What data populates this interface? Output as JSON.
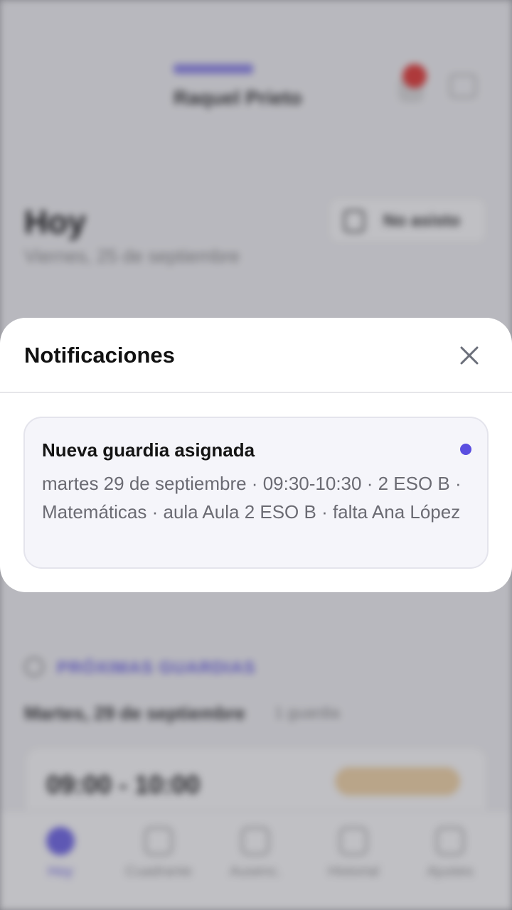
{
  "background": {
    "header": {
      "name": "Raquel Prieto"
    },
    "today": {
      "title": "Hoy",
      "date": "Viernes, 25 de septiembre"
    },
    "no_school_button": {
      "label": "No asisto",
      "icon": "calendar-icon"
    },
    "upcoming": {
      "label": "PRÓXIMAS GUARDIAS",
      "day": "Martes, 29 de septiembre",
      "count": "1 guardia"
    },
    "slot": {
      "time": "09:00 - 10:00"
    },
    "tabs": [
      {
        "label": "Hoy",
        "icon": "home-icon",
        "active": true
      },
      {
        "label": "Cuadrante",
        "icon": "grid-icon"
      },
      {
        "label": "Ausenc.",
        "icon": "clock-icon"
      },
      {
        "label": "Historial",
        "icon": "history-icon"
      },
      {
        "label": "Ajustes",
        "icon": "settings-icon"
      }
    ]
  },
  "sheet": {
    "title": "Notificaciones",
    "close_icon": "close-icon",
    "notifications": [
      {
        "title": "Nueva guardia asignada",
        "body": "martes 29 de septiembre · 09:30-10:30 · 2 ESO B · Matemáticas · aula Aula 2 ESO B · falta Ana López",
        "unread": true
      }
    ]
  },
  "colors": {
    "accent": "#5a4ee0",
    "badge": "#e53935"
  }
}
